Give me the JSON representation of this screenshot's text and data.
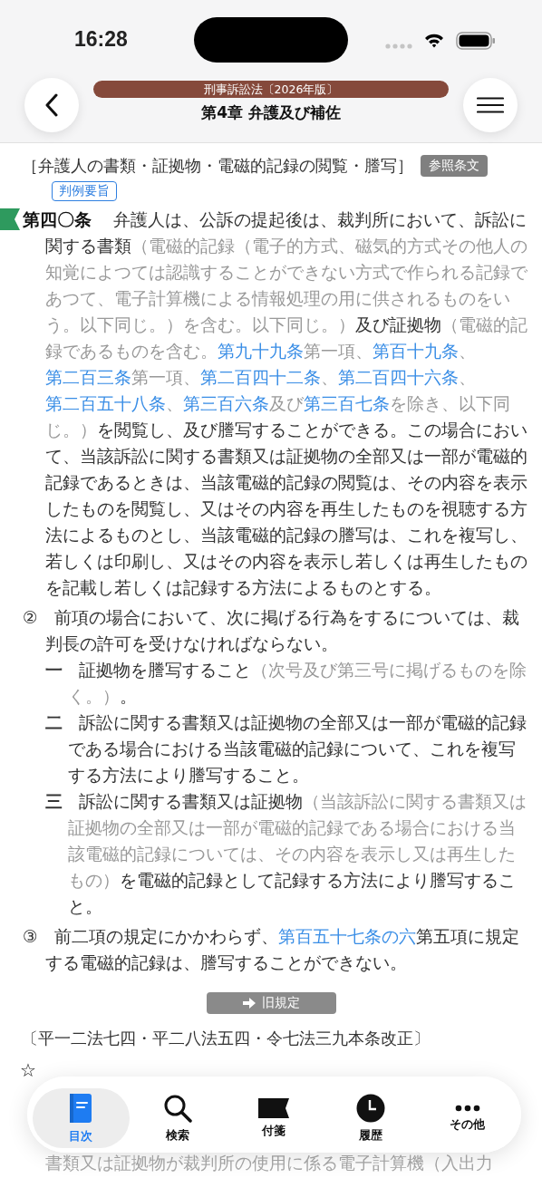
{
  "status_bar": {
    "time": "16:28"
  },
  "header": {
    "book": "刑事訴訟法〔2026年版〕",
    "chapter": "第4章 弁護及び補佐"
  },
  "article": {
    "heading": "［弁護人の書類・証拠物・電磁的記録の閲覧・謄写］",
    "reference_button": "参照条文",
    "case_button": "判例要旨",
    "bookmarked": true,
    "paragraphs": [
      {
        "kind": "article",
        "label": "第四〇条",
        "segments": [
          {
            "kind": "text",
            "text": "弁護人は、公訴の提起後は、裁判所において、訴訟に関する書類"
          },
          {
            "kind": "note",
            "text": "（電磁的記録（電子的方式、磁気的方式その他人の知覚によつては認識することができない方式で作られる記録であつて、電子計算機による情報処理の用に供されるものをいう。以下同じ。）を含む。以下同じ。）"
          },
          {
            "kind": "text",
            "text": "及び証拠物"
          },
          {
            "kind": "note",
            "text": "（電磁的記録であるものを含む。"
          },
          {
            "kind": "link",
            "text": "第九十九条"
          },
          {
            "kind": "note",
            "text": "第一項、"
          },
          {
            "kind": "link",
            "text": "第百十九条"
          },
          {
            "kind": "note",
            "text": "、"
          },
          {
            "kind": "link",
            "text": "第二百三条"
          },
          {
            "kind": "note",
            "text": "第一項、"
          },
          {
            "kind": "link",
            "text": "第二百四十二条"
          },
          {
            "kind": "note",
            "text": "、"
          },
          {
            "kind": "link",
            "text": "第二百四十六条"
          },
          {
            "kind": "note",
            "text": "、"
          },
          {
            "kind": "link",
            "text": "第二百五十八条"
          },
          {
            "kind": "note",
            "text": "、"
          },
          {
            "kind": "link",
            "text": "第三百六条"
          },
          {
            "kind": "note",
            "text": "及び"
          },
          {
            "kind": "link",
            "text": "第三百七条"
          },
          {
            "kind": "note",
            "text": "を除き、以下同じ。）"
          },
          {
            "kind": "text",
            "text": "を閲覧し、及び謄写することができる。この場合において、当該訴訟に関する書類又は証拠物の全部又は一部が電磁的記録であるときは、当該電磁的記録の閲覧は、その内容を表示したものを閲覧し、又はその内容を再生したものを視聴する方法によるものとし、当該電磁的記録の謄写は、これを複写し、若しくは印刷し、又はその内容を表示し若しくは再生したものを記載し若しくは記録する方法によるものとする。"
          }
        ]
      },
      {
        "kind": "paragraph",
        "label": "②",
        "segments": [
          {
            "kind": "text",
            "text": "前項の場合において、次に掲げる行為をするについては、裁判長の許可を受けなければならない。"
          }
        ]
      },
      {
        "kind": "item",
        "label": "一",
        "segments": [
          {
            "kind": "text",
            "text": "証拠物を謄写すること"
          },
          {
            "kind": "note",
            "text": "（次号及び第三号に掲げるものを除く。）"
          },
          {
            "kind": "text",
            "text": "。"
          }
        ]
      },
      {
        "kind": "item",
        "label": "二",
        "segments": [
          {
            "kind": "text",
            "text": "訴訟に関する書類又は証拠物の全部又は一部が電磁的記録である場合における当該電磁的記録について、これを複写する方法により謄写すること。"
          }
        ]
      },
      {
        "kind": "item",
        "label": "三",
        "segments": [
          {
            "kind": "text",
            "text": "訴訟に関する書類又は証拠物"
          },
          {
            "kind": "note",
            "text": "（当該訴訟に関する書類又は証拠物の全部又は一部が電磁的記録である場合における当該電磁的記録については、その内容を表示し又は再生したもの）"
          },
          {
            "kind": "text",
            "text": "を電磁的記録として記録する方法により謄写すること。"
          }
        ]
      },
      {
        "kind": "paragraph",
        "label": "③",
        "segments": [
          {
            "kind": "text",
            "text": "前二項の規定にかかわらず、"
          },
          {
            "kind": "link",
            "text": "第百五十七条の六"
          },
          {
            "kind": "text",
            "text": "第五項に規定する電磁的記録は、謄写することができない。"
          }
        ]
      }
    ]
  },
  "old_rule_button": "旧規定",
  "amendment": "〔平一二法七四・平二八法五四・令七法三九本条改正〕",
  "star": "☆",
  "faded_line": "書類又は証拠物が裁判所の使用に係る電子計算機（入出力",
  "tab_bar": [
    {
      "kind": "contents",
      "label": "目次",
      "selected": true
    },
    {
      "kind": "search",
      "label": "検索",
      "selected": false
    },
    {
      "kind": "sticky",
      "label": "付箋",
      "selected": false
    },
    {
      "kind": "history",
      "label": "履歴",
      "selected": false
    },
    {
      "kind": "more",
      "label": "その他",
      "selected": false
    }
  ]
}
